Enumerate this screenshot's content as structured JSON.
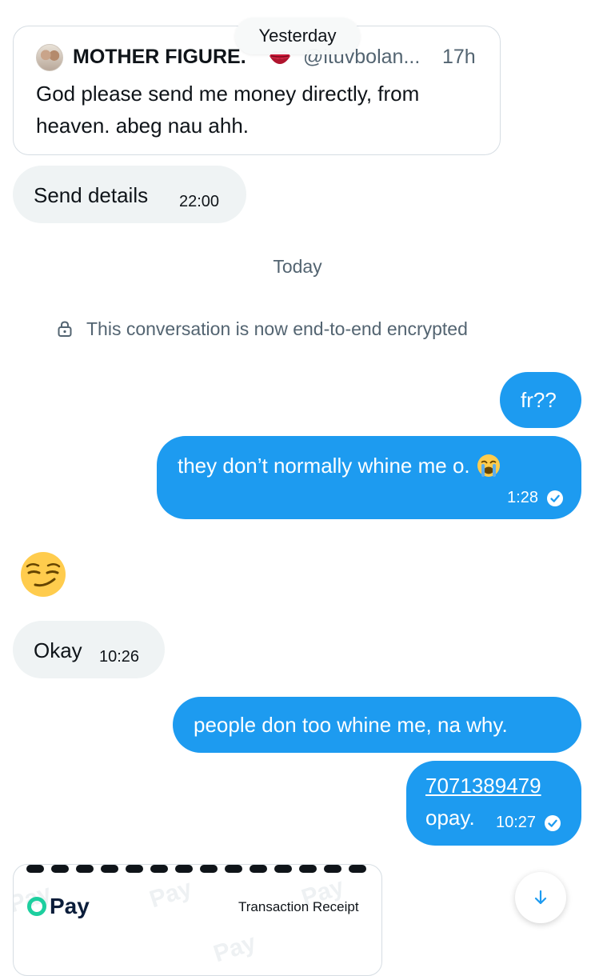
{
  "date_separators": {
    "yesterday": "Yesterday",
    "today": "Today"
  },
  "quoted_tweet": {
    "author_name": "MOTHER FIGURE.",
    "handle": "@ituvbolan...",
    "time": "17h",
    "text": "God please send me money directly, from heaven. abeg nau ahh."
  },
  "encryption_notice": "This conversation is now end-to-end encrypted",
  "messages": [
    {
      "direction": "incoming",
      "text": "Send details",
      "time": "22:00"
    },
    {
      "direction": "outgoing",
      "text": "fr??"
    },
    {
      "direction": "outgoing",
      "text": "they don’t normally whine me o.",
      "emoji": "crying-face",
      "time": "1:28",
      "read": true
    },
    {
      "direction": "incoming",
      "emoji": "smirking-face"
    },
    {
      "direction": "incoming",
      "text": "Okay",
      "time": "10:26"
    },
    {
      "direction": "outgoing",
      "text": "people don too whine me, na why."
    },
    {
      "direction": "outgoing",
      "phone": "7071389479",
      "text": "opay.",
      "time": "10:27",
      "read": true
    }
  ],
  "receipt": {
    "brand": "Pay",
    "title": "Transaction Receipt",
    "watermark": "Pay"
  },
  "colors": {
    "outgoing_bubble": "#1d9bf0",
    "incoming_bubble": "#eff3f4",
    "muted_text": "#536471",
    "opay_green": "#1dcf9f"
  },
  "icons": [
    "lips-icon",
    "lock-icon",
    "check-circle-icon",
    "arrow-down-icon"
  ]
}
